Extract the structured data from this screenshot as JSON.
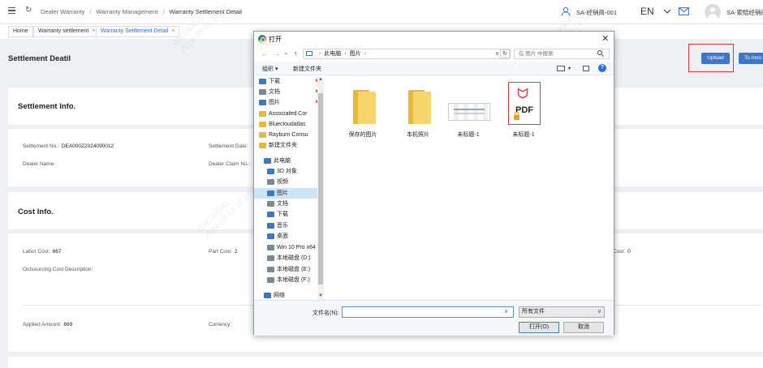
{
  "header": {
    "breadcrumb": [
      "Dealer Warranty",
      "Warranty Management",
      "Warranty Settlement Detail"
    ],
    "user_role": "SA-经销商-001",
    "language": "EN",
    "user_name": "SA-索赔经销商"
  },
  "tabs": [
    {
      "label": "Home"
    },
    {
      "label": "Warranty settlement"
    },
    {
      "label": "Warranty Settlement Detail",
      "active": true
    }
  ],
  "page": {
    "title": "Settlement Deatil",
    "upload_label": "Upload",
    "invoice_label": "To Invo"
  },
  "settlement_info": {
    "title": "Settlement Info.",
    "settlement_no_label": "Settlement No.:",
    "settlement_no_value": "DEA000Z2024090012",
    "settlement_date_label": "Settlement Date:",
    "dealer_name_label": "Dealer Name:",
    "dealer_claim_no_label": "Dealer Claim No.:"
  },
  "cost_info": {
    "title": "Cost Info.",
    "labor_cost_label": "Labor Cost:",
    "labor_cost_value": "667",
    "part_cost_label": "Part Cost:",
    "part_cost_value": "2",
    "other_cost_label": "Cost:",
    "other_cost_value": "0",
    "outsourcing_label": "Outsourcing Cost Description:",
    "applied_amount_label": "Applied Amount:",
    "applied_amount_value": "669",
    "currency_label": "Currency:"
  },
  "watermark": {
    "line1": "GW240045",
    "line2": "2024-09-14 10:28"
  },
  "dialog": {
    "title": "打开",
    "path": [
      "此电脑",
      "图片"
    ],
    "search_placeholder": "在 图片 中搜索",
    "organize_label": "组织 ▾",
    "new_folder_label": "新建文件夹",
    "nav_items": [
      {
        "label": "下载",
        "icon": "download-arrow",
        "pinned": true
      },
      {
        "label": "文档",
        "icon": "document",
        "pinned": true
      },
      {
        "label": "图片",
        "icon": "picture",
        "pinned": true
      },
      {
        "label": "Associated Cor",
        "icon": "folder"
      },
      {
        "label": "Bluecloudatlas",
        "icon": "folder"
      },
      {
        "label": "Rayburn Consu",
        "icon": "folder"
      },
      {
        "label": "新建文件夹",
        "icon": "folder"
      },
      {
        "label": "此电脑",
        "icon": "computer"
      },
      {
        "label": "3D 对象",
        "icon": "cube"
      },
      {
        "label": "视频",
        "icon": "video"
      },
      {
        "label": "图片",
        "icon": "picture",
        "selected": true
      },
      {
        "label": "文档",
        "icon": "document"
      },
      {
        "label": "下载",
        "icon": "download-arrow"
      },
      {
        "label": "音乐",
        "icon": "music-note"
      },
      {
        "label": "桌面",
        "icon": "desktop"
      },
      {
        "label": "Win 10 Pro x64",
        "icon": "drive"
      },
      {
        "label": "本地磁盘 (D:)",
        "icon": "drive"
      },
      {
        "label": "本地磁盘 (E:)",
        "icon": "drive"
      },
      {
        "label": "本地磁盘 (F:)",
        "icon": "drive"
      },
      {
        "label": "网络",
        "icon": "network"
      }
    ],
    "files": [
      {
        "label": "保存的图片",
        "type": "folder"
      },
      {
        "label": "本机照片",
        "type": "folder"
      },
      {
        "label": "未标题-1",
        "type": "image"
      },
      {
        "label": "未标题-1",
        "type": "pdf",
        "badge": "PDF"
      }
    ],
    "filename_label": "文件名(N):",
    "filename_value": "",
    "filetype_value": "所有文件",
    "open_label": "打开(O)",
    "cancel_label": "取消"
  }
}
